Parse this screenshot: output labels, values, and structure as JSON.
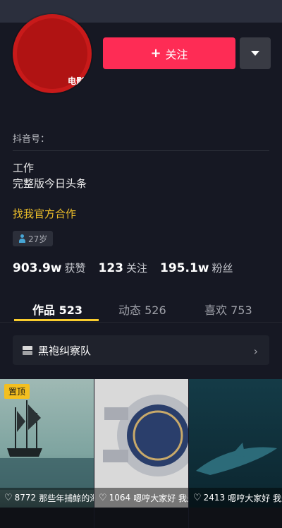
{
  "profile": {
    "avatar_label": "电影",
    "nickname": "",
    "douyin_id": "抖音号：",
    "bio_lines": [
      "工作",
      "完整版今日头条"
    ],
    "contact": "找我官方合作",
    "age": "27岁"
  },
  "actions": {
    "follow_label": "关注",
    "follow_plus": "+"
  },
  "stats": [
    {
      "value": "903.9w",
      "label": "获赞"
    },
    {
      "value": "123",
      "label": "关注"
    },
    {
      "value": "195.1w",
      "label": "粉丝"
    }
  ],
  "tabs": [
    {
      "label": "作品 523",
      "active": true
    },
    {
      "label": "动态 526",
      "active": false
    },
    {
      "label": "喜欢 753",
      "active": false
    }
  ],
  "collection": {
    "label": "黑袍纠察队"
  },
  "videos": [
    {
      "pinned": "置顶",
      "likes": "8772",
      "caption": "那些年捕鲸的海域"
    },
    {
      "pinned": "",
      "likes": "1064",
      "caption": "嗯哼大家好  我是牛叔"
    },
    {
      "pinned": "",
      "likes": "2413",
      "caption": "嗯哼大家好  我是牛叔"
    }
  ],
  "colors": {
    "background": "#161823",
    "follow_button": "#fe2c55",
    "accent_yellow": "#facd2e",
    "pinned_badge": "#f3bf1f"
  }
}
